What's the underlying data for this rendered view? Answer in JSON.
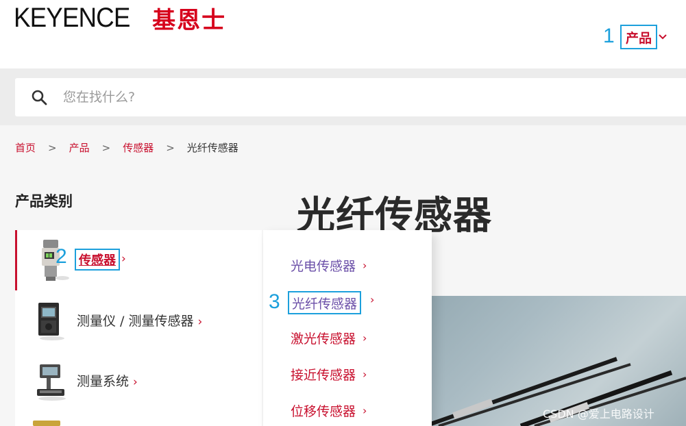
{
  "header": {
    "logo_en": "KEYENCE",
    "logo_cn": "基恩士",
    "nav_num": "1",
    "nav_products": "产品",
    "nav_chevron": "⌄"
  },
  "search": {
    "placeholder": "您在找什么?"
  },
  "breadcrumb": {
    "items": [
      "首页",
      "产品",
      "传感器"
    ],
    "sep": ">",
    "current": "光纤传感器"
  },
  "sidebar": {
    "title": "产品类别",
    "items": [
      {
        "label": "传感器",
        "num": "2"
      },
      {
        "label": "测量仪 / 测量传感器"
      },
      {
        "label": "测量系统"
      }
    ],
    "chevron": "›"
  },
  "page_title": "光纤传感器",
  "submenu": {
    "num": "3",
    "items": [
      {
        "label": "光电传感器"
      },
      {
        "label": "光纤传感器"
      },
      {
        "label": "激光传感器"
      },
      {
        "label": "接近传感器"
      },
      {
        "label": "位移传感器"
      }
    ],
    "chevron": "›"
  },
  "watermark": "CSDN @爱上电路设计",
  "colors": {
    "brand_red": "#c8102e",
    "annotation_blue": "#1ca0dc",
    "submenu_purple": "#6b4fa8"
  }
}
